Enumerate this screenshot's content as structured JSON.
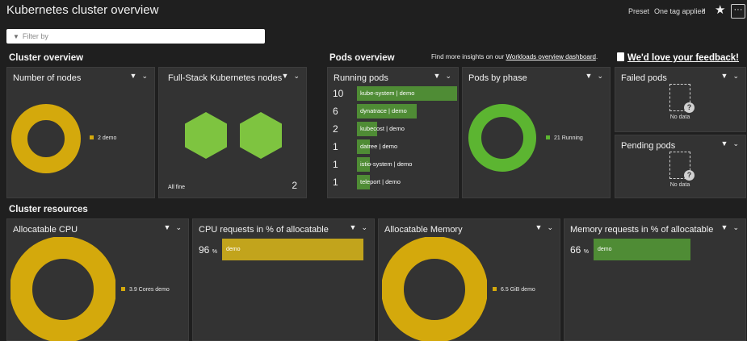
{
  "header": {
    "title": "Kubernetes cluster overview",
    "preset": "Preset",
    "tag_applied": "One tag applied",
    "chevron_icon": "chevron-right-icon",
    "star_icon": "star-icon",
    "more_label": "···"
  },
  "filter": {
    "placeholder": "Filter by",
    "icon": "funnel-icon"
  },
  "sections": {
    "cluster_overview": "Cluster overview",
    "pods_overview": "Pods overview",
    "cluster_resources": "Cluster resources",
    "insights_prefix": "Find more insights on our",
    "insights_link": "Workloads overview dashboard",
    "insights_suffix": ".",
    "feedback": "We'd love your feedback!"
  },
  "tiles": {
    "nodes": {
      "title": "Number of nodes",
      "legend": "2 demo",
      "color": "#d4a90c"
    },
    "fullstack": {
      "title": "Full-Stack Kubernetes nodes",
      "status": "All fine",
      "count": "2",
      "color": "#7ec440"
    },
    "running_pods": {
      "title": "Running pods",
      "rows": [
        {
          "count": "10",
          "label": "kube-system | demo",
          "value": 10
        },
        {
          "count": "6",
          "label": "dynatrace | demo",
          "value": 6
        },
        {
          "count": "2",
          "label": "kubecost | demo",
          "value": 2
        },
        {
          "count": "1",
          "label": "datree | demo",
          "value": 1
        },
        {
          "count": "1",
          "label": "istio-system | demo",
          "value": 1
        },
        {
          "count": "1",
          "label": "teleport | demo",
          "value": 1
        }
      ],
      "color": "#4f8c35"
    },
    "pods_phase": {
      "title": "Pods by phase",
      "legend": "21 Running",
      "color": "#5cb531"
    },
    "failed": {
      "title": "Failed pods",
      "nodata": "No data"
    },
    "pending": {
      "title": "Pending pods",
      "nodata": "No data"
    },
    "alloc_cpu": {
      "title": "Allocatable CPU",
      "legend": "3.9 Cores demo",
      "color": "#d4a90c"
    },
    "cpu_requests": {
      "title": "CPU requests in % of allocatable",
      "value": "96",
      "unit": "%",
      "label": "demo",
      "percent": 96,
      "color": "#c2a41c"
    },
    "alloc_mem": {
      "title": "Allocatable Memory",
      "legend": "6.5 GiB demo",
      "color": "#d4a90c"
    },
    "mem_requests": {
      "title": "Memory requests in % of allocatable",
      "value": "66",
      "unit": "%",
      "label": "demo",
      "percent": 66,
      "color": "#4f8c35"
    }
  },
  "tile_controls": {
    "filter_icon": "funnel-icon",
    "chevron_icon": "chevron-down-icon"
  }
}
